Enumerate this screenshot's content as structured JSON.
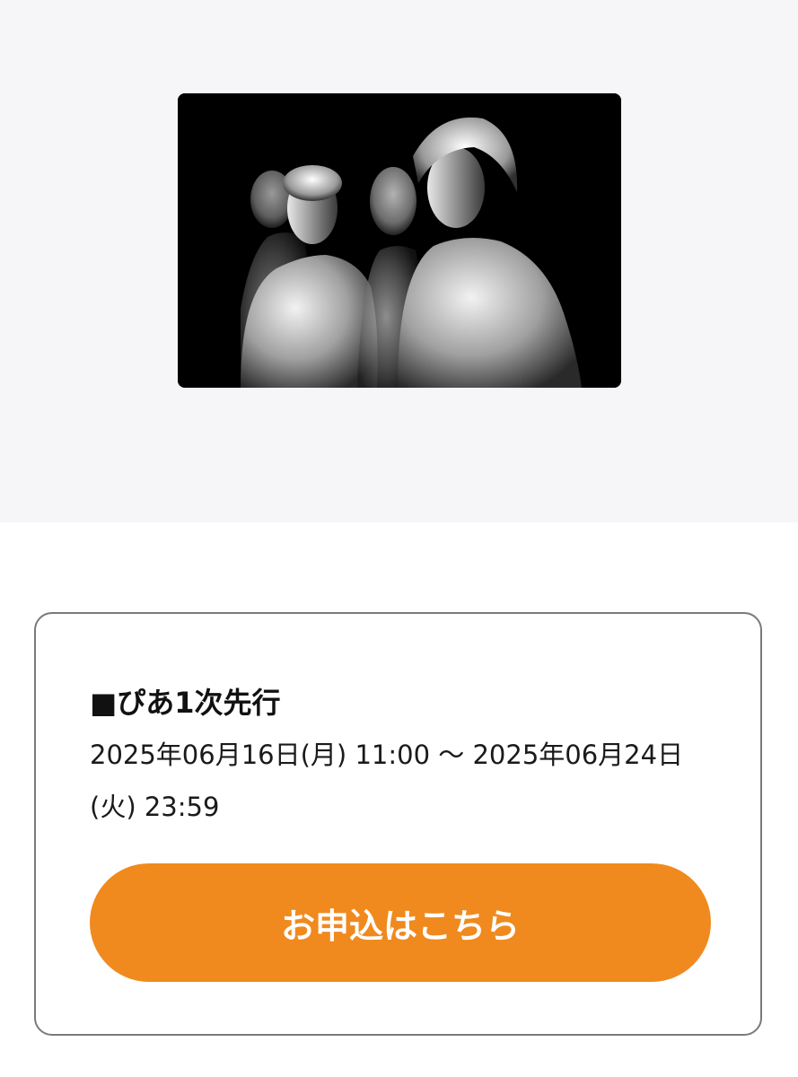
{
  "hero": {
    "image_alt": "band-photo"
  },
  "ticket": {
    "title": "■ぴあ1次先行",
    "period": "2025年06月16日(月) 11:00 〜 2025年06月24日(火) 23:59",
    "apply_label": "お申込はこちら",
    "accent_color": "#f08a1e"
  }
}
